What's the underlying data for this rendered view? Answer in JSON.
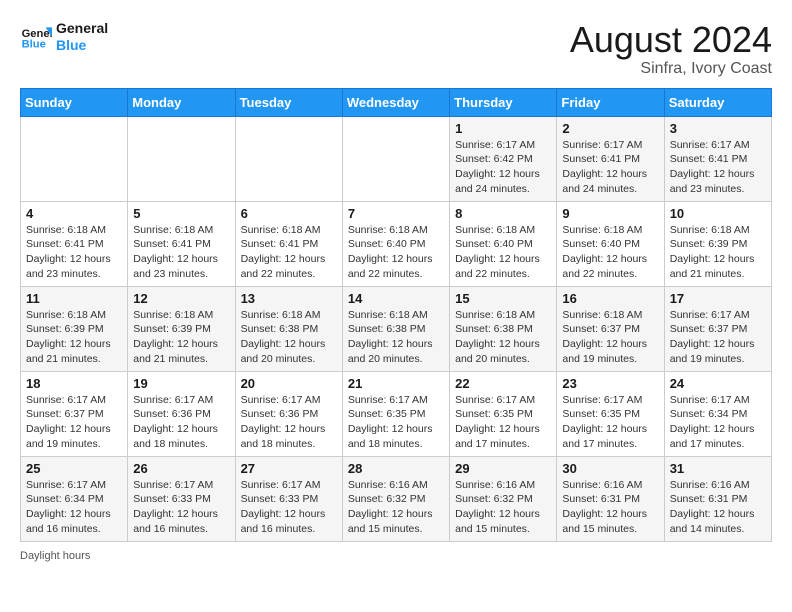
{
  "header": {
    "logo_text_general": "General",
    "logo_text_blue": "Blue",
    "month_year": "August 2024",
    "location": "Sinfra, Ivory Coast"
  },
  "calendar": {
    "days_of_week": [
      "Sunday",
      "Monday",
      "Tuesday",
      "Wednesday",
      "Thursday",
      "Friday",
      "Saturday"
    ],
    "weeks": [
      [
        {
          "day": "",
          "info": ""
        },
        {
          "day": "",
          "info": ""
        },
        {
          "day": "",
          "info": ""
        },
        {
          "day": "",
          "info": ""
        },
        {
          "day": "1",
          "info": "Sunrise: 6:17 AM\nSunset: 6:42 PM\nDaylight: 12 hours\nand 24 minutes."
        },
        {
          "day": "2",
          "info": "Sunrise: 6:17 AM\nSunset: 6:41 PM\nDaylight: 12 hours\nand 24 minutes."
        },
        {
          "day": "3",
          "info": "Sunrise: 6:17 AM\nSunset: 6:41 PM\nDaylight: 12 hours\nand 23 minutes."
        }
      ],
      [
        {
          "day": "4",
          "info": "Sunrise: 6:18 AM\nSunset: 6:41 PM\nDaylight: 12 hours\nand 23 minutes."
        },
        {
          "day": "5",
          "info": "Sunrise: 6:18 AM\nSunset: 6:41 PM\nDaylight: 12 hours\nand 23 minutes."
        },
        {
          "day": "6",
          "info": "Sunrise: 6:18 AM\nSunset: 6:41 PM\nDaylight: 12 hours\nand 22 minutes."
        },
        {
          "day": "7",
          "info": "Sunrise: 6:18 AM\nSunset: 6:40 PM\nDaylight: 12 hours\nand 22 minutes."
        },
        {
          "day": "8",
          "info": "Sunrise: 6:18 AM\nSunset: 6:40 PM\nDaylight: 12 hours\nand 22 minutes."
        },
        {
          "day": "9",
          "info": "Sunrise: 6:18 AM\nSunset: 6:40 PM\nDaylight: 12 hours\nand 22 minutes."
        },
        {
          "day": "10",
          "info": "Sunrise: 6:18 AM\nSunset: 6:39 PM\nDaylight: 12 hours\nand 21 minutes."
        }
      ],
      [
        {
          "day": "11",
          "info": "Sunrise: 6:18 AM\nSunset: 6:39 PM\nDaylight: 12 hours\nand 21 minutes."
        },
        {
          "day": "12",
          "info": "Sunrise: 6:18 AM\nSunset: 6:39 PM\nDaylight: 12 hours\nand 21 minutes."
        },
        {
          "day": "13",
          "info": "Sunrise: 6:18 AM\nSunset: 6:38 PM\nDaylight: 12 hours\nand 20 minutes."
        },
        {
          "day": "14",
          "info": "Sunrise: 6:18 AM\nSunset: 6:38 PM\nDaylight: 12 hours\nand 20 minutes."
        },
        {
          "day": "15",
          "info": "Sunrise: 6:18 AM\nSunset: 6:38 PM\nDaylight: 12 hours\nand 20 minutes."
        },
        {
          "day": "16",
          "info": "Sunrise: 6:18 AM\nSunset: 6:37 PM\nDaylight: 12 hours\nand 19 minutes."
        },
        {
          "day": "17",
          "info": "Sunrise: 6:17 AM\nSunset: 6:37 PM\nDaylight: 12 hours\nand 19 minutes."
        }
      ],
      [
        {
          "day": "18",
          "info": "Sunrise: 6:17 AM\nSunset: 6:37 PM\nDaylight: 12 hours\nand 19 minutes."
        },
        {
          "day": "19",
          "info": "Sunrise: 6:17 AM\nSunset: 6:36 PM\nDaylight: 12 hours\nand 18 minutes."
        },
        {
          "day": "20",
          "info": "Sunrise: 6:17 AM\nSunset: 6:36 PM\nDaylight: 12 hours\nand 18 minutes."
        },
        {
          "day": "21",
          "info": "Sunrise: 6:17 AM\nSunset: 6:35 PM\nDaylight: 12 hours\nand 18 minutes."
        },
        {
          "day": "22",
          "info": "Sunrise: 6:17 AM\nSunset: 6:35 PM\nDaylight: 12 hours\nand 17 minutes."
        },
        {
          "day": "23",
          "info": "Sunrise: 6:17 AM\nSunset: 6:35 PM\nDaylight: 12 hours\nand 17 minutes."
        },
        {
          "day": "24",
          "info": "Sunrise: 6:17 AM\nSunset: 6:34 PM\nDaylight: 12 hours\nand 17 minutes."
        }
      ],
      [
        {
          "day": "25",
          "info": "Sunrise: 6:17 AM\nSunset: 6:34 PM\nDaylight: 12 hours\nand 16 minutes."
        },
        {
          "day": "26",
          "info": "Sunrise: 6:17 AM\nSunset: 6:33 PM\nDaylight: 12 hours\nand 16 minutes."
        },
        {
          "day": "27",
          "info": "Sunrise: 6:17 AM\nSunset: 6:33 PM\nDaylight: 12 hours\nand 16 minutes."
        },
        {
          "day": "28",
          "info": "Sunrise: 6:16 AM\nSunset: 6:32 PM\nDaylight: 12 hours\nand 15 minutes."
        },
        {
          "day": "29",
          "info": "Sunrise: 6:16 AM\nSunset: 6:32 PM\nDaylight: 12 hours\nand 15 minutes."
        },
        {
          "day": "30",
          "info": "Sunrise: 6:16 AM\nSunset: 6:31 PM\nDaylight: 12 hours\nand 15 minutes."
        },
        {
          "day": "31",
          "info": "Sunrise: 6:16 AM\nSunset: 6:31 PM\nDaylight: 12 hours\nand 14 minutes."
        }
      ]
    ]
  },
  "footer": {
    "text": "Daylight hours"
  }
}
